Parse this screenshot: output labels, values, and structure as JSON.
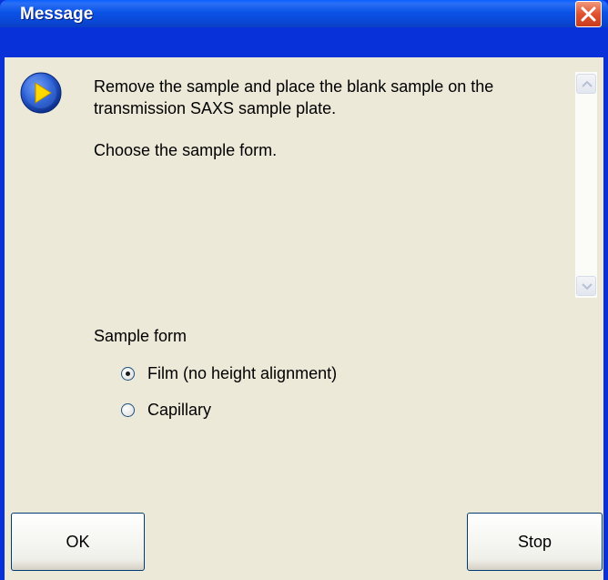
{
  "window": {
    "title": "Message",
    "close_icon": "close-icon"
  },
  "message": {
    "icon": "play-arrow-icon",
    "line1": "Remove the sample and place the blank sample on the transmission SAXS sample plate.",
    "line2": "Choose the sample form."
  },
  "sample_form": {
    "label": "Sample form",
    "options": [
      {
        "label": "Film (no height alignment)",
        "selected": true
      },
      {
        "label": "Capillary",
        "selected": false
      }
    ]
  },
  "buttons": {
    "ok_label": "OK",
    "stop_label": "Stop"
  },
  "colors": {
    "titlebar": "#0a53e6",
    "face": "#ece9d8",
    "close": "#df5130",
    "icon_blue": "#1a4fbf",
    "icon_yellow": "#ffd800"
  }
}
